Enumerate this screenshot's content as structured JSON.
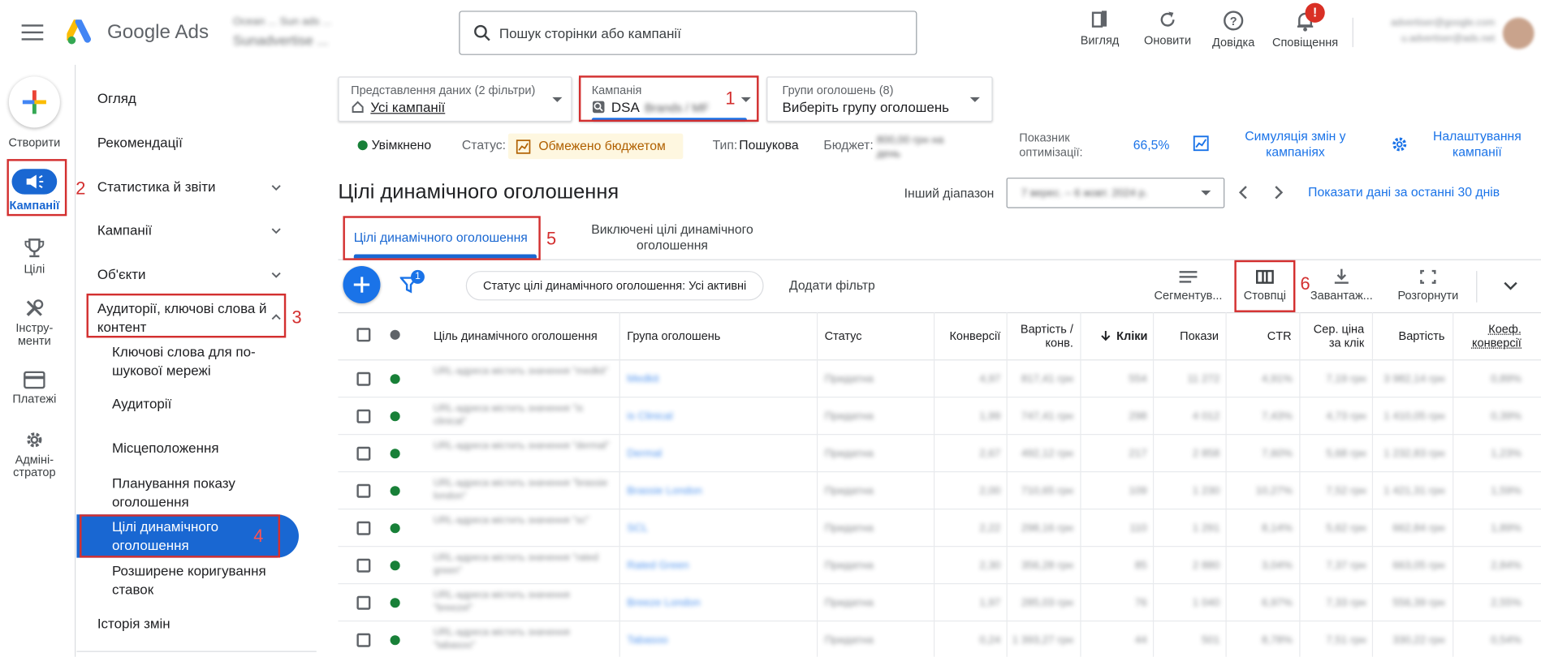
{
  "header": {
    "app_name": "Google Ads",
    "account_name": "Ocean ... Sun ads ...",
    "account_id": "Sunadvertise ...",
    "search_placeholder": "Пошук сторінки або кампанії",
    "actions": [
      {
        "icon": "view-icon",
        "label": "Вигляд"
      },
      {
        "icon": "refresh-icon",
        "label": "Оновити"
      },
      {
        "icon": "help-icon",
        "label": "Довідка"
      },
      {
        "icon": "bell-icon",
        "label": "Сповіщення",
        "badge": "!"
      }
    ],
    "user_email_1": "advertiser@google.com",
    "user_email_2": "u.advertiser@ads.net"
  },
  "rail": [
    {
      "icon": "plus-icon",
      "label": "Створити"
    },
    {
      "icon": "campaigns-icon",
      "label": "Кампанії"
    },
    {
      "icon": "trophy-icon",
      "label": "Цілі"
    },
    {
      "icon": "tools-icon",
      "label": "Інстру-\nменти"
    },
    {
      "icon": "card-icon",
      "label": "Платежі"
    },
    {
      "icon": "gear-icon",
      "label": "Адміні-\nстратор"
    }
  ],
  "nav": {
    "items": [
      "Огляд",
      "Рекомендації",
      "Статистика й звіти",
      "Кампанії",
      "Об'єкти",
      "Аудиторії, ключові слова й контент"
    ],
    "sub_items": [
      "Ключові слова для по-\nшукової мережі",
      "Аудиторії",
      "Місцеположення",
      "Планування показу\nоголошення",
      "Цілі динамічного\nоголошення",
      "Розширене коригування\nставок"
    ],
    "footer_item": "Історія змін"
  },
  "filters": {
    "data_view_label": "Представлення даних (2 фільтри)",
    "data_view_value": "Усі кампанії",
    "campaign_label": "Кампанія",
    "campaign_value": "DSA",
    "campaign_value_hidden": "Brands / MF",
    "adgroups_label": "Групи оголошень (8)",
    "adgroups_value": "Виберіть групу оголошень"
  },
  "status_bar": {
    "enabled": "Увімкнено",
    "status_label": "Статус:",
    "status_value": "Обмежено бюджетом",
    "type_label": "Тип:",
    "type_value": "Пошукова",
    "budget_label": "Бюджет:",
    "budget_value": "800,00 грн на день",
    "opt_label": "Показник оптимізації:",
    "opt_value": "66,5%",
    "simulation": "Симуляція змін у кампаніях",
    "settings": "Налаштування кампанії"
  },
  "page": {
    "title": "Цілі динамічного оголошення",
    "range_label": "Інший діапазон",
    "range_value": "7 верес. – 6 жовт. 2024 р.",
    "show_last_30": "Показати дані за останні 30 днів",
    "tab_active": "Цілі динамічного оголошення",
    "tab_other": "Виключені цілі динамічного\nоголошення"
  },
  "toolbar": {
    "filter_badge": "1",
    "status_filter": "Статус цілі динамічного оголошення: Усі активні",
    "add_filter": "Додати фільтр",
    "segment": "Сегментув...",
    "columns": "Стовпці",
    "download": "Завантаж...",
    "expand": "Розгорнути"
  },
  "annotations": [
    "1",
    "2",
    "3",
    "4",
    "5",
    "6"
  ],
  "table": {
    "columns": [
      "Ціль динамічного оголошення",
      "Група оголошень",
      "Статус",
      "Конверсії",
      "Вартість /\nконв.",
      "Кліки",
      "Покази",
      "CTR",
      "Сер. ціна\nза клік",
      "Вартість",
      "Коеф.\nконверсії"
    ],
    "rows": [
      [
        "URL-адреса містить значення \"medkit\"",
        "Medkit",
        "Придатна",
        "4,97",
        "817,41 грн",
        "554",
        "11 272",
        "4,91%",
        "7,19 грн",
        "3 982,14 грн",
        "0,89%"
      ],
      [
        "URL-адреса містить значення \"is clinical\"",
        "is Clinical",
        "Придатна",
        "1,99",
        "747,41 грн",
        "298",
        "4 012",
        "7,43%",
        "4,73 грн",
        "1 410,05 грн",
        "0,39%"
      ],
      [
        "URL-адреса містить значення \"dermal\"",
        "Dermal",
        "Придатна",
        "2,67",
        "492,12 грн",
        "217",
        "2 858",
        "7,60%",
        "5,68 грн",
        "1 232,83 грн",
        "1,23%"
      ],
      [
        "URL-адреса містить значення \"brassie london\"",
        "Brassie London",
        "Придатна",
        "2,00",
        "710,65 грн",
        "109",
        "1 230",
        "10,27%",
        "7,52 грн",
        "1 421,31 грн",
        "1,59%"
      ],
      [
        "URL-адреса містить значення \"sc\"",
        "SCL",
        "Придатна",
        "2,22",
        "298,16 грн",
        "110",
        "1 291",
        "8,14%",
        "5,62 грн",
        "662,84 грн",
        "1,89%"
      ],
      [
        "URL-адреса містить значення \"rated green\"",
        "Rated Green",
        "Придатна",
        "2,30",
        "356,28 грн",
        "85",
        "2 880",
        "3,04%",
        "7,37 грн",
        "663,05 грн",
        "2,84%"
      ],
      [
        "URL-адреса містить значення \"breezel\"",
        "Breeze London",
        "Придатна",
        "1,97",
        "285,03 грн",
        "76",
        "1 040",
        "6,97%",
        "7,33 грн",
        "556,39 грн",
        "2,55%"
      ],
      [
        "URL-адреса містить значення \"tabasoo\"",
        "Tabasoo",
        "Придатна",
        "0,24",
        "1 393,27 грн",
        "44",
        "501",
        "8,78%",
        "7,51 грн",
        "330,22 грн",
        "0,54%"
      ]
    ]
  },
  "colors": {
    "accent": "#1a73e8",
    "annotation": "#d32f2f",
    "enabled": "#188038",
    "nav_selected": "#1967d2",
    "warning_bg": "#fef7e0",
    "warning_text": "#b06000"
  }
}
